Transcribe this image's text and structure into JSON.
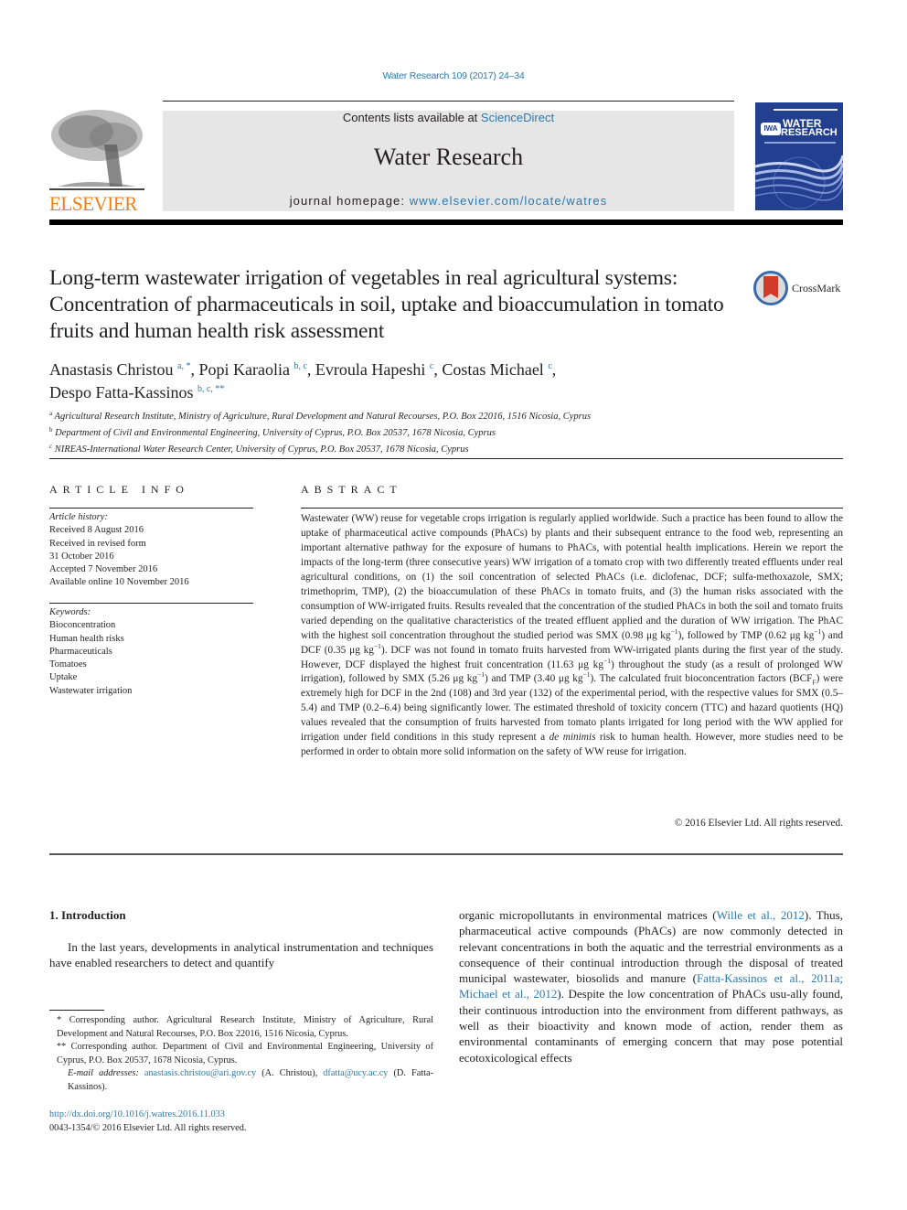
{
  "header": {
    "citation": "Water Research 109 (2017) 24–34",
    "publisher_logo_text": "ELSEVIER",
    "contents_prefix": "Contents lists available at ",
    "contents_link": "ScienceDirect",
    "journal_title": "Water Research",
    "homepage_prefix": "journal homepage: ",
    "homepage_link": "www.elsevier.com/locate/watres",
    "cover": {
      "badge": "IWA",
      "line1": "WATER",
      "line2": "RESEARCH"
    },
    "colors": {
      "link": "#2a7ab0",
      "elsevier_orange": "#f07f1b",
      "cover_blue": "#233f8f",
      "masthead_gray": "#e6e6e6"
    }
  },
  "article": {
    "title": "Long-term wastewater irrigation of vegetables in real agricultural systems: Concentration of pharmaceuticals in soil, uptake and bioaccumulation in tomato fruits and human health risk assessment",
    "crossmark_label": "CrossMark",
    "authors": [
      {
        "name": "Anastasis Christou",
        "sup": "a, *",
        "sep": ", "
      },
      {
        "name": "Popi Karaolia",
        "sup": "b, c",
        "sep": ", "
      },
      {
        "name": "Evroula Hapeshi",
        "sup": "c",
        "sep": ", "
      },
      {
        "name": "Costas Michael",
        "sup": "c",
        "sep": ","
      },
      {
        "name": "Despo Fatta-Kassinos",
        "sup": "b, c, **",
        "sep": ""
      }
    ],
    "affiliations": [
      {
        "key": "a",
        "text": "Agricultural Research Institute, Ministry of Agriculture, Rural Development and Natural Recourses, P.O. Box 22016, 1516 Nicosia, Cyprus"
      },
      {
        "key": "b",
        "text": "Department of Civil and Environmental Engineering, University of Cyprus, P.O. Box 20537, 1678 Nicosia, Cyprus"
      },
      {
        "key": "c",
        "text": "NIREAS-International Water Research Center, University of Cyprus, P.O. Box 20537, 1678 Nicosia, Cyprus"
      }
    ]
  },
  "article_info": {
    "heading": "ARTICLE INFO",
    "history_label": "Article history:",
    "history": [
      "Received 8 August 2016",
      "Received in revised form",
      "31 October 2016",
      "Accepted 7 November 2016",
      "Available online 10 November 2016"
    ],
    "keywords_label": "Keywords:",
    "keywords": [
      "Bioconcentration",
      "Human health risks",
      "Pharmaceuticals",
      "Tomatoes",
      "Uptake",
      "Wastewater irrigation"
    ]
  },
  "abstract": {
    "heading": "ABSTRACT",
    "p1": "Wastewater (WW) reuse for vegetable crops irrigation is regularly applied worldwide. Such a practice has been found to allow the uptake of pharmaceutical active compounds (PhACs) by plants and their subsequent entrance to the food web, representing an important alternative pathway for the exposure of humans to PhACs, with potential health implications. Herein we report the impacts of the long-term (three consecutive years) WW irrigation of a tomato crop with two differently treated effluents under real agricultural conditions, on (1) the soil concentration of selected PhACs (i.e. diclofenac, DCF; sulfa-methoxazole, SMX; trimethoprim, TMP), (2) the bioaccumulation of these PhACs in tomato fruits, and (3) the human risks associated with the consumption of WW-irrigated fruits. Results revealed that the concentration of the studied PhACs in both the soil and tomato fruits varied depending on the qualitative characteristics of the treated effluent applied and the duration of WW irrigation. The PhAC with the highest soil concentration throughout the studied period was SMX (0.98 μg kg",
    "p2": "), followed by TMP (0.62 μg kg",
    "p3": ") and DCF (0.35 μg kg",
    "p4": "). DCF was not found in tomato fruits harvested from WW-irrigated plants during the first year of the study. However, DCF displayed the highest fruit concentration (11.63 μg kg",
    "p5": ") throughout the study (as a result of prolonged WW irrigation), followed by SMX (5.26 μg kg",
    "p6": ") and TMP (3.40 μg kg",
    "p7": "). The calculated fruit bioconcentration factors (BCF",
    "p7_sub": "F",
    "p8": ") were extremely high for DCF in the 2nd (108) and 3rd year (132) of the experimental period, with the respective values for SMX (0.5–5.4) and TMP (0.2–6.4) being significantly lower. The estimated threshold of toxicity concern (TTC) and hazard quotients (HQ) values revealed that the consumption of fruits harvested from tomato plants irrigated for long period with the WW applied for irrigation under field conditions in this study represent a ",
    "p8_italic": "de minimis",
    "p9": " risk to human health. However, more studies need to be performed in order to obtain more solid information on the safety of WW reuse for irrigation.",
    "exp": "−1",
    "copyright": "© 2016 Elsevier Ltd. All rights reserved."
  },
  "introduction": {
    "heading": "1.  Introduction",
    "p1": "In the last years, developments in analytical instrumentation and techniques have enabled researchers to detect and quantify",
    "r1": "organic micropollutants in environmental matrices (",
    "r1_link": "Wille et al., 2012",
    "r2": "). Thus, pharmaceutical active compounds (PhACs) are now commonly detected in relevant concentrations in both the aquatic and the terrestrial environments as a consequence of their continual introduction through the disposal of treated municipal wastewater, biosolids and manure (",
    "r2_link": "Fatta-Kassinos et al., 2011a; Michael et al., 2012",
    "r3": "). Despite the low concentration of PhACs usu-ally found, their continuous introduction into the environment from different pathways, as well as their bioactivity and known mode of action, render them as environmental contaminants of emerging concern that may pose potential ecotoxicological effects"
  },
  "footnotes": {
    "fn1": "* Corresponding author. Agricultural Research Institute, Ministry of Agriculture, Rural Development and Natural Recourses, P.O. Box 22016, 1516 Nicosia, Cyprus.",
    "fn2": "** Corresponding author. Department of Civil and Environmental Engineering, University of Cyprus, P.O. Box 20537, 1678 Nicosia, Cyprus.",
    "email_label": "E-mail addresses:",
    "email1": "anastasis.christou@ari.gov.cy",
    "email1_owner": " (A. Christou), ",
    "email2": "dfatta@ucy.ac.cy",
    "email2_owner": " (D. Fatta-Kassinos).",
    "doi": "http://dx.doi.org/10.1016/j.watres.2016.11.033",
    "issn": "0043-1354/© 2016 Elsevier Ltd. All rights reserved."
  }
}
